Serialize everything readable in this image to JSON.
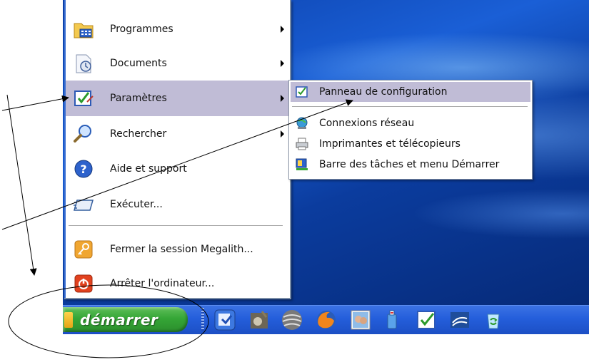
{
  "start_menu": {
    "items": [
      {
        "label": "Programmes",
        "icon": "programs-folder-icon",
        "has_submenu": true
      },
      {
        "label": "Documents",
        "icon": "documents-icon",
        "has_submenu": true
      },
      {
        "label": "Paramètres",
        "icon": "settings-icon",
        "has_submenu": true,
        "highlighted": true
      },
      {
        "label": "Rechercher",
        "icon": "search-icon",
        "has_submenu": true
      },
      {
        "label": "Aide et support",
        "icon": "help-icon",
        "has_submenu": false
      },
      {
        "label": "Exécuter...",
        "icon": "run-icon",
        "has_submenu": false
      },
      {
        "label": "Fermer la session Megalith...",
        "icon": "logoff-key-icon",
        "has_submenu": false
      },
      {
        "label": "Arrêter l'ordinateur...",
        "icon": "shutdown-icon",
        "has_submenu": false
      }
    ]
  },
  "settings_submenu": {
    "items": [
      {
        "label": "Panneau de configuration",
        "icon": "control-panel-icon",
        "highlighted": true
      },
      {
        "label": "Connexions réseau",
        "icon": "network-connections-icon"
      },
      {
        "label": "Imprimantes et télécopieurs",
        "icon": "printer-fax-icon"
      },
      {
        "label": "Barre des tâches et menu Démarrer",
        "icon": "taskbar-start-menu-icon"
      }
    ]
  },
  "taskbar": {
    "start_label": "démarrer",
    "quick_launch": [
      "control-panel-launch-icon",
      "gimp-icon",
      "sphere-icon",
      "firefox-icon",
      "photo-viewer-icon",
      "bottle-icon",
      "checklist-icon",
      "openoffice-icon",
      "recycle-icon"
    ]
  },
  "colors": {
    "menu_highlight": "#c0bcd6",
    "taskbar_blue": "#245edb",
    "start_green": "#35a636",
    "desktop_blue": "#1a5fd6"
  }
}
